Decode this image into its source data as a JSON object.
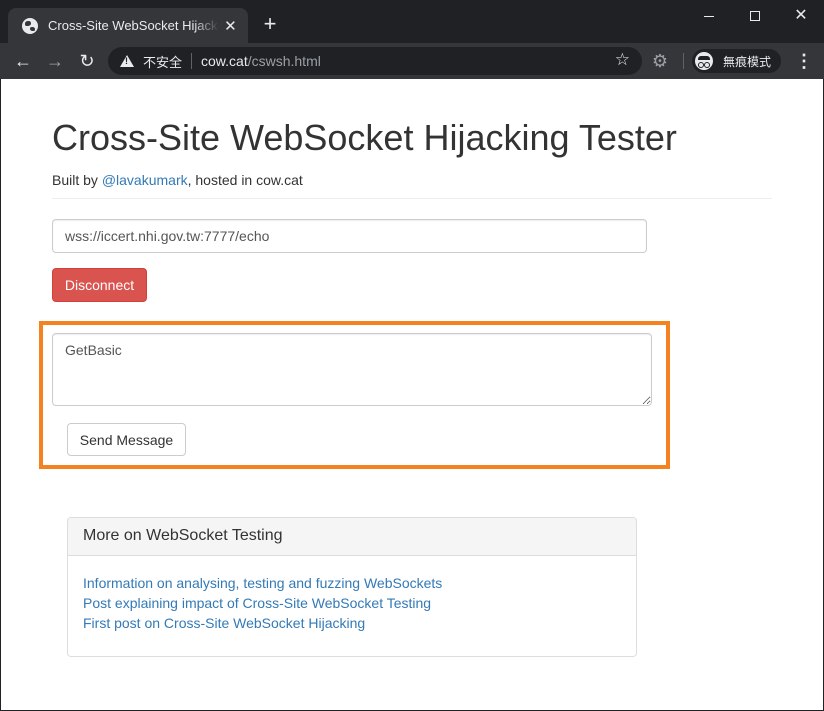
{
  "browser": {
    "tab_title": "Cross-Site WebSocket Hijacking Tester",
    "tab_close": "✕",
    "new_tab": "+",
    "window_close": "✕",
    "nav_back": "←",
    "nav_forward": "→",
    "nav_reload": "↻",
    "security_label": "不安全",
    "url_host": "cow.cat",
    "url_path": "/cswsh.html",
    "bookmark_star": "☆",
    "extension_icon": "⚙",
    "incognito_label": "無痕模式",
    "menu_icon": "⋮"
  },
  "page": {
    "title": "Cross-Site WebSocket Hijacking Tester",
    "byline_prefix": "Built by ",
    "author_link": "@lavakumark",
    "byline_suffix": ", hosted in cow.cat",
    "ws_url": "wss://iccert.nhi.gov.tw:7777/echo",
    "disconnect_label": "Disconnect",
    "message_text": "GetBasic",
    "send_label": "Send Message"
  },
  "panel": {
    "heading": "More on WebSocket Testing",
    "links": [
      "Information on analysing, testing and fuzzing WebSockets",
      "Post explaining impact of Cross-Site WebSocket Testing",
      "First post on Cross-Site WebSocket Hijacking"
    ]
  },
  "colors": {
    "highlight": "#f58220",
    "danger": "#d9534f",
    "link": "#337ab7",
    "chrome_dark": "#202124",
    "chrome_toolbar": "#35363a"
  }
}
